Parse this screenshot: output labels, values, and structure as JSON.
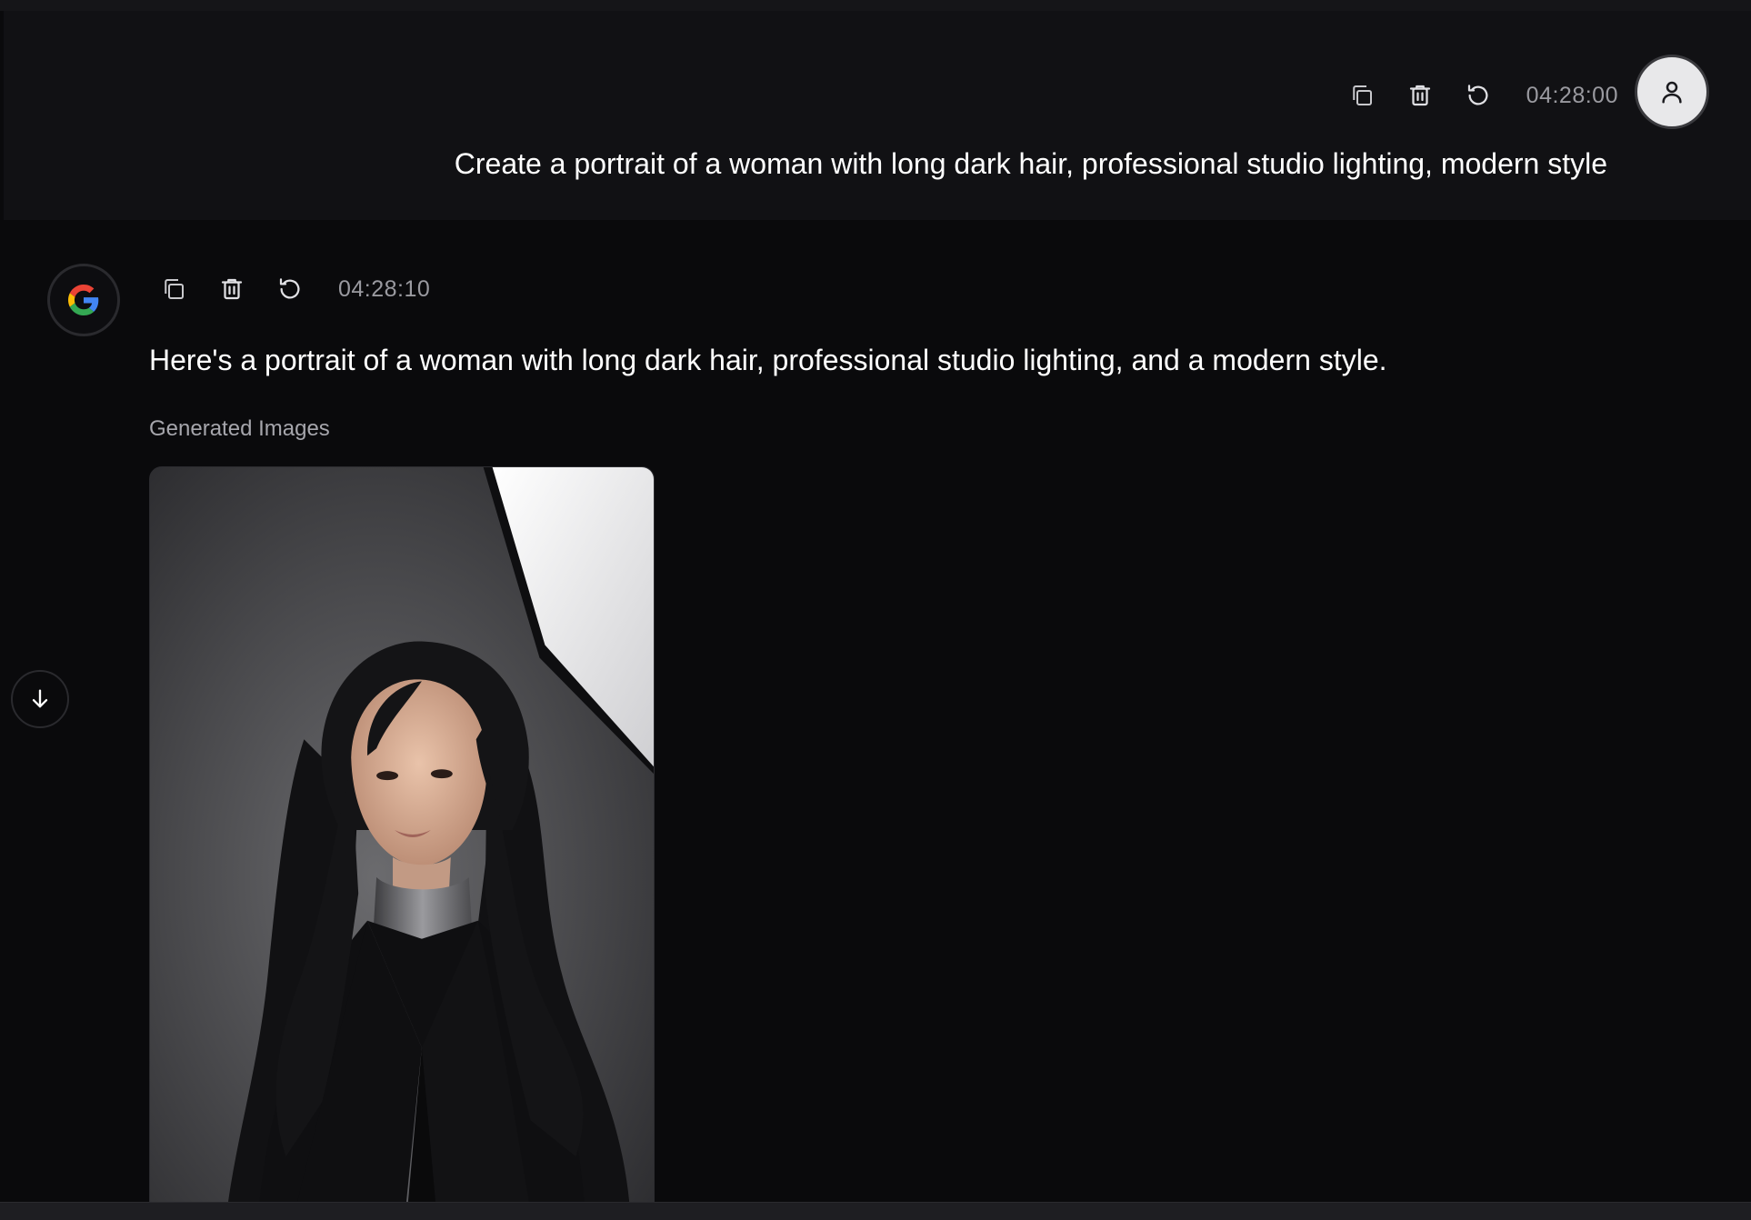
{
  "user_turn": {
    "timestamp": "04:28:00",
    "message": "Create a portrait of a woman with long dark hair, professional studio lighting, modern style",
    "actions": [
      "copy-icon",
      "trash-icon",
      "refresh-icon"
    ],
    "avatar_icon": "user-icon"
  },
  "assistant_turn": {
    "timestamp": "04:28:10",
    "message": "Here's a portrait of a woman with long dark hair, professional studio lighting, and a modern style.",
    "section_label": "Generated Images",
    "actions": [
      "copy-icon",
      "trash-icon",
      "refresh-icon"
    ],
    "avatar_icon": "google-logo-icon"
  },
  "controls": {
    "scroll_down_icon": "arrow-down-icon"
  },
  "colors": {
    "background": "#0a0a0c",
    "user_block": "#111114",
    "text": "#ffffff",
    "muted_text": "#9a9aa0",
    "user_avatar_bg": "#e8e8ea",
    "google_blue": "#4285F4",
    "google_red": "#EA4335",
    "google_yellow": "#FBBC05",
    "google_green": "#34A853"
  }
}
